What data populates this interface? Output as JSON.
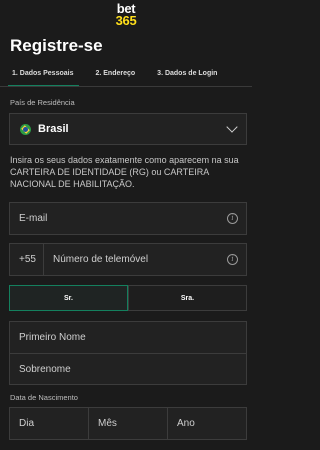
{
  "logo": {
    "line1": "bet",
    "line2": "365"
  },
  "page_title": "Registre-se",
  "steps": [
    {
      "label": "1. Dados Pessoais",
      "active": true
    },
    {
      "label": "2. Endereço",
      "active": false
    },
    {
      "label": "3. Dados de Login",
      "active": false
    }
  ],
  "residence": {
    "label": "País de Residência",
    "value": "Brasil",
    "icon": "brazil-flag-icon"
  },
  "instructions": "Insira os seus dados exatamente como aparecem na sua CARTEIRA DE IDENTIDADE (RG) ou CARTEIRA NACIONAL DE HABILITAÇÃO.",
  "email": {
    "placeholder": "E-mail",
    "icon": "info-icon"
  },
  "phone": {
    "prefix": "+55",
    "placeholder": "Número de telemóvel",
    "icon": "info-icon"
  },
  "title_options": {
    "selected": "Sr.",
    "other": "Sra."
  },
  "name": {
    "first_placeholder": "Primeiro Nome",
    "last_placeholder": "Sobrenome"
  },
  "dob": {
    "label": "Data de Nascimento",
    "day": "Dia",
    "month": "Mês",
    "year": "Ano"
  },
  "colors": {
    "accent": "#14805e",
    "logo_yellow": "#ffdf1b",
    "background": "#1b1b1b"
  }
}
